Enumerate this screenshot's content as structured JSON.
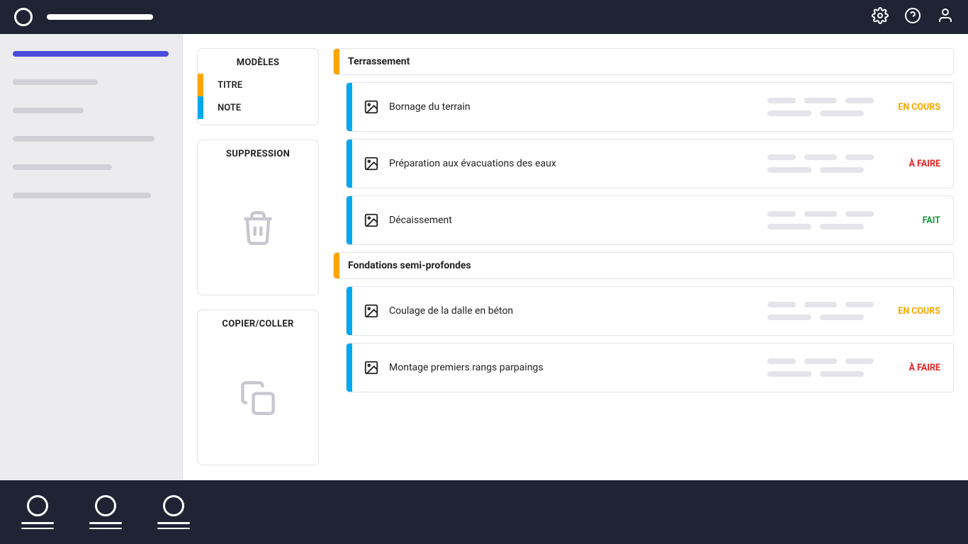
{
  "colors": {
    "accent_orange": "#f9a600",
    "accent_blue": "#00a8ef",
    "nav_active": "#4b4ddb",
    "status_en_cours": "#f9a600",
    "status_a_faire": "#e32222",
    "status_fait": "#159a3b"
  },
  "panels": {
    "models": {
      "title": "MODÈLES",
      "items": [
        {
          "label": "TITRE",
          "tag": "orange"
        },
        {
          "label": "NOTE",
          "tag": "blue"
        }
      ]
    },
    "suppression": {
      "title": "SUPPRESSION",
      "icon": "trash-icon"
    },
    "copier_coller": {
      "title": "COPIER/COLLER",
      "icon": "copy-icon"
    }
  },
  "sections": [
    {
      "title": "Terrassement",
      "tag": "orange",
      "tasks": [
        {
          "title": "Bornage du terrain",
          "status_key": "en-cours",
          "status_label": "EN COURS"
        },
        {
          "title": "Préparation aux évacuations des eaux",
          "status_key": "a-faire",
          "status_label": "À FAIRE"
        },
        {
          "title": "Décaissement",
          "status_key": "fait",
          "status_label": "FAIT"
        }
      ]
    },
    {
      "title": "Fondations semi-profondes",
      "tag": "orange",
      "tasks": [
        {
          "title": "Coulage de la dalle en béton",
          "status_key": "en-cours",
          "status_label": "EN COURS"
        },
        {
          "title": "Montage premiers rangs parpaings",
          "status_key": "a-faire",
          "status_label": "À FAIRE"
        }
      ]
    }
  ]
}
